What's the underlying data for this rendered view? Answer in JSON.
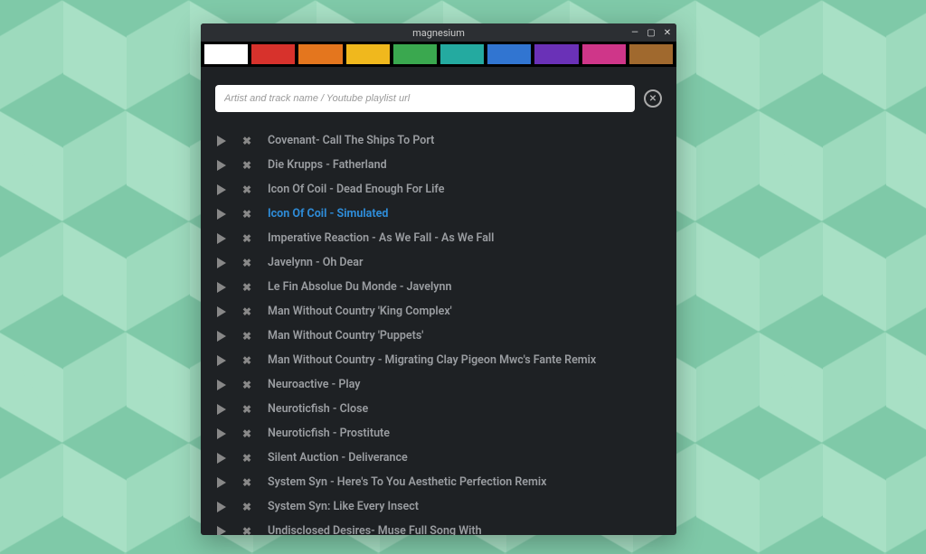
{
  "window": {
    "title": "magnesium"
  },
  "colors": [
    "#ffffff",
    "#d7322c",
    "#e4761e",
    "#f0b81d",
    "#3aa84f",
    "#24aaa0",
    "#3175d1",
    "#6a31b7",
    "#cf3689",
    "#a0692e"
  ],
  "search": {
    "placeholder": "Artist and track name / Youtube playlist url",
    "value": ""
  },
  "tracks": [
    {
      "title": "Covenant- Call The Ships To Port",
      "active": false
    },
    {
      "title": "Die Krupps - Fatherland",
      "active": false
    },
    {
      "title": "Icon Of Coil - Dead Enough For Life",
      "active": false
    },
    {
      "title": "Icon Of Coil - Simulated",
      "active": true
    },
    {
      "title": "Imperative Reaction - As We Fall - As We Fall",
      "active": false
    },
    {
      "title": "Javelynn - Oh Dear",
      "active": false
    },
    {
      "title": "Le Fin Absolue Du Monde - Javelynn",
      "active": false
    },
    {
      "title": "Man Without Country 'King Complex'",
      "active": false
    },
    {
      "title": "Man Without Country 'Puppets'",
      "active": false
    },
    {
      "title": "Man Without Country - Migrating Clay Pigeon Mwc's Fante Remix",
      "active": false
    },
    {
      "title": "Neuroactive - Play",
      "active": false
    },
    {
      "title": "Neuroticfish - Close",
      "active": false
    },
    {
      "title": "Neuroticfish - Prostitute",
      "active": false
    },
    {
      "title": "Silent Auction - Deliverance",
      "active": false
    },
    {
      "title": "System Syn - Here's To You Aesthetic Perfection Remix",
      "active": false
    },
    {
      "title": "System Syn: Like Every Insect",
      "active": false
    },
    {
      "title": "Undisclosed Desires- Muse Full Song With",
      "active": false
    }
  ]
}
